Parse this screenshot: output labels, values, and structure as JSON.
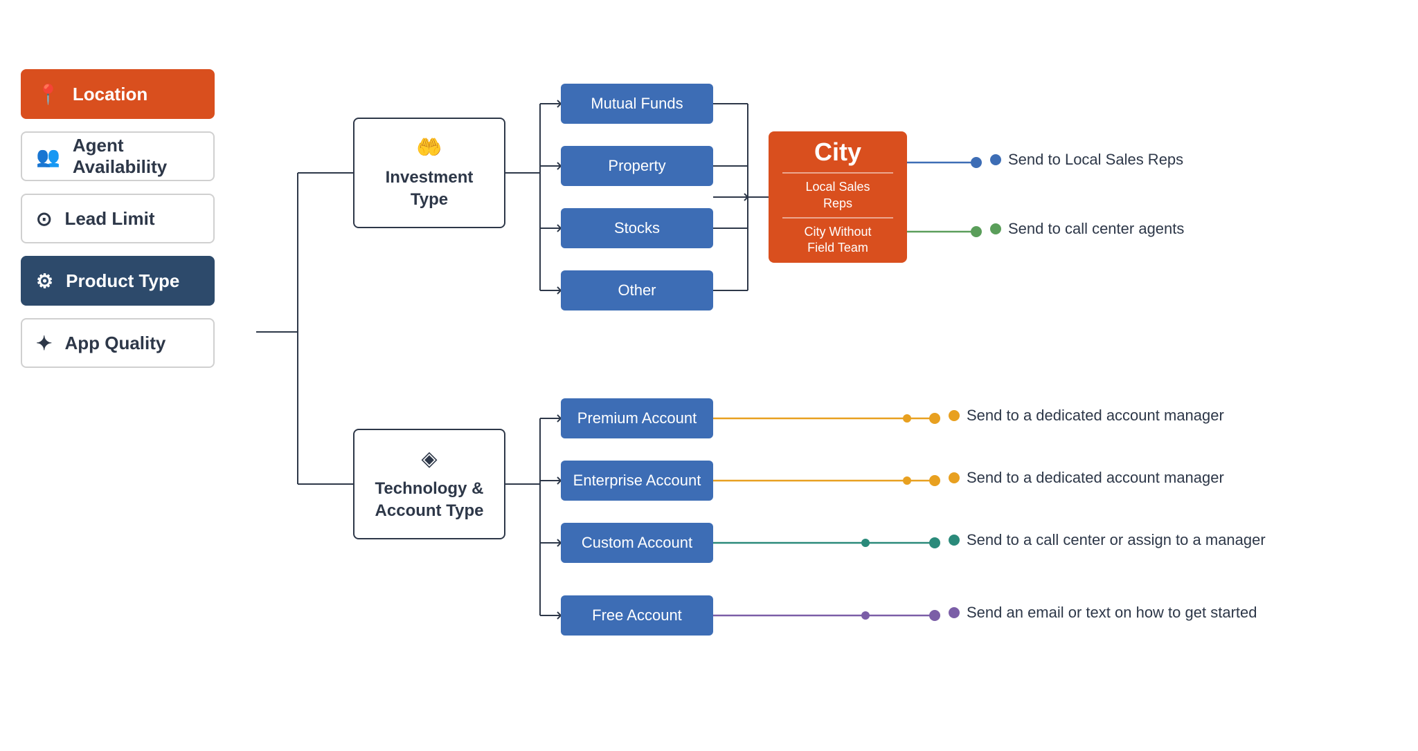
{
  "sidebar": {
    "items": [
      {
        "label": "Location",
        "icon": "📍",
        "state": "orange"
      },
      {
        "label": "Agent Availability",
        "icon": "👥",
        "state": "normal"
      },
      {
        "label": "Lead Limit",
        "icon": "⊙",
        "state": "normal"
      },
      {
        "label": "Product Type",
        "icon": "⚙",
        "state": "active"
      },
      {
        "label": "App Quality",
        "icon": "✦",
        "state": "normal"
      }
    ]
  },
  "investment_box": {
    "icon": "🤲",
    "label": "Investment\nType"
  },
  "technology_box": {
    "icon": "◈",
    "label": "Technology &\nAccount Type"
  },
  "investment_options": [
    "Mutual Funds",
    "Property",
    "Stocks",
    "Other"
  ],
  "technology_options": [
    "Premium Account",
    "Enterprise Account",
    "Custom Account",
    "Free Account"
  ],
  "city_box": {
    "title": "City",
    "sub1": "Local Sales\nReps",
    "sub2": "City Without\nField Team"
  },
  "results_investment": [
    {
      "text": "Send to Local Sales Reps",
      "dot_color": "blue"
    },
    {
      "text": "Send to call center agents",
      "dot_color": "green"
    }
  ],
  "results_technology": [
    {
      "text": "Send to a dedicated account manager",
      "dot_color": "orange"
    },
    {
      "text": "Send to a dedicated account manager",
      "dot_color": "orange"
    },
    {
      "text": "Send to a call center or assign to a manager",
      "dot_color": "teal"
    },
    {
      "text": "Send an email or text on how to get started",
      "dot_color": "purple"
    }
  ]
}
